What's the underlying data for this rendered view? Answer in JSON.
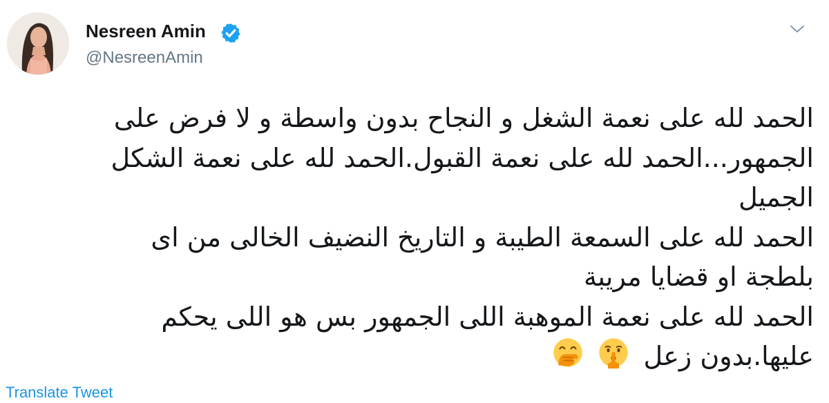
{
  "author": {
    "display_name": "Nesreen Amin",
    "handle": "@NesreenAmin",
    "verified": true,
    "avatar": "profile-photo"
  },
  "tweet": {
    "lines": [
      "الحمد لله على نعمة الشغل و النجاح بدون واسطة و لا فرض على",
      "الجمهور...الحمد لله على نعمة القبول.الحمد لله على نعمة الشكل",
      "الجميل",
      "الحمد لله على السمعة الطيبة و التاريخ النضيف الخالى من اى",
      "بلطجة او قضايا مريبة",
      "الحمد لله على نعمة الموهبة اللى الجمهور بس هو اللى يحكم",
      "عليها.بدون زعل"
    ],
    "emojis": [
      "shushing-face",
      "face-with-hand-over-mouth"
    ]
  },
  "actions": {
    "translate_label": "Translate Tweet",
    "menu_icon": "chevron-down-icon"
  },
  "colors": {
    "text": "#14171a",
    "secondary": "#657786",
    "link": "#1b95e0",
    "verified": "#1da1f2",
    "emoji": "#ffcc4d"
  }
}
